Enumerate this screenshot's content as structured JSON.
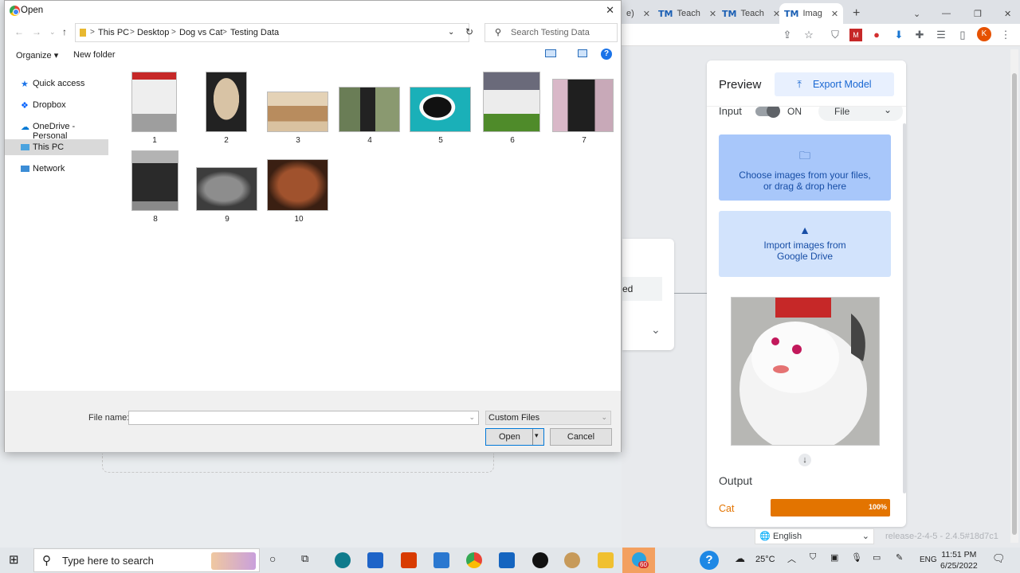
{
  "browser": {
    "tabs": [
      {
        "label": "Teach",
        "icon": "TM"
      },
      {
        "label": "Teach",
        "icon": "TM"
      },
      {
        "label": "Imag",
        "icon": "TM"
      }
    ],
    "partial_tab_text": "e)",
    "profile_initial": "K"
  },
  "teachable": {
    "preview_title": "Preview",
    "export_label": "Export Model",
    "input_label": "Input",
    "toggle_state": "ON",
    "source_select": "File",
    "choose_line1": "Choose images from your files,",
    "choose_line2": "or drag & drop here",
    "drive_line1": "Import images from",
    "drive_line2": "Google Drive",
    "output_title": "Output",
    "prediction_label": "Cat",
    "prediction_percent": "100%",
    "prediction_fraction": 1.0,
    "left_card_chip": "ed",
    "language": "English",
    "release": "release-2-4-5 - 2.4.5#18d7c1"
  },
  "dialog": {
    "title": "Open",
    "breadcrumbs": [
      "This PC",
      "Desktop",
      "Dog vs Cat",
      "Testing Data"
    ],
    "search_placeholder": "Search Testing Data",
    "organize": "Organize",
    "new_folder": "New folder",
    "nav_items": [
      "Quick access",
      "Dropbox",
      "OneDrive - Personal",
      "This PC",
      "Network"
    ],
    "files": [
      "1",
      "2",
      "3",
      "4",
      "5",
      "6",
      "7",
      "8",
      "9",
      "10"
    ],
    "file_name_label": "File name:",
    "file_name_value": "",
    "filter": "Custom Files",
    "open_label": "Open",
    "cancel_label": "Cancel"
  },
  "taskbar": {
    "search_placeholder": "Type here to search",
    "temperature": "25°C",
    "language": "ENG",
    "time": "11:51 PM",
    "date": "6/25/2022",
    "badge": "60"
  }
}
